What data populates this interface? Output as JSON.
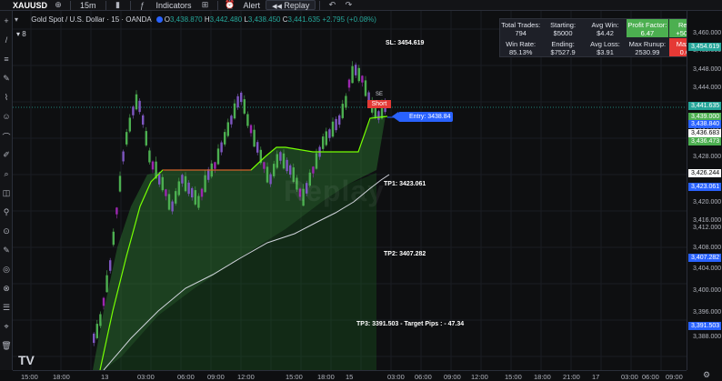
{
  "toolbar": {
    "symbol": "XAUUSD",
    "add_icon": "⊕",
    "interval": "15m",
    "chart_type_icon": "▮",
    "indicators_icon": "ƒ",
    "indicators": "Indicators",
    "layout_icon": "⊞",
    "alert_icon": "⏰",
    "alert": "Alert",
    "replay_icon": "◀◀",
    "replay": "Replay",
    "undo_icon": "↶",
    "redo_icon": "↷"
  },
  "legend": {
    "title": "Gold Spot / U.S. Dollar · 15 · OANDA",
    "o_label": "O",
    "o": "3,438.870",
    "h_label": "H",
    "h": "3,442.480",
    "l_label": "L",
    "l": "3,438.450",
    "c_label": "C",
    "c": "3,441.635",
    "change": "+2.795 (+0.08%)",
    "sub": "8"
  },
  "stats": [
    {
      "label": "Total Trades:",
      "value": "794"
    },
    {
      "label": "Starting:",
      "value": "$5000"
    },
    {
      "label": "Avg Win:",
      "value": "$4.42"
    },
    {
      "label": "Profit Factor:",
      "value": "6.47"
    },
    {
      "label": "Return:",
      "value": "+50.55%"
    },
    {
      "label": "Win Rate:",
      "value": "85.13%"
    },
    {
      "label": "Ending:",
      "value": "$7527.9"
    },
    {
      "label": "Avg Loss:",
      "value": "$3.91"
    },
    {
      "label": "Max Runup:",
      "value": "2530.99"
    },
    {
      "label": "Max DD:",
      "value": "0.65%"
    }
  ],
  "annotations": {
    "sl": "SL: 3454.619",
    "entry": "Entry: 3438.84",
    "tp1": "TP1: 3423.061",
    "tp2": "TP2: 3407.282",
    "tp3": "TP3: 3391.503 - Target Pips : - 47.34",
    "short": "Short",
    "se": "SE",
    "watermark": "Replay",
    "tv_logo": "TV"
  },
  "price_axis": {
    "ticks": [
      "3,460.000",
      "3,452.000",
      "3,448.000",
      "3,444.000",
      "3,432.000",
      "3,428.000",
      "3,420.000",
      "3,416.000",
      "3,412.000",
      "3,408.000",
      "3,404.000",
      "3,400.000",
      "3,396.000",
      "3,388.000"
    ],
    "labels": [
      {
        "text": "3,454.619",
        "color": "#26a69a"
      },
      {
        "text": "3,441.635",
        "color": "#26a69a"
      },
      {
        "text": "3,439.000",
        "color": "#4caf50"
      },
      {
        "text": "3,438.840",
        "color": "#2962ff"
      },
      {
        "text": "3,436.683",
        "color": "#ffffff"
      },
      {
        "text": "3,436.473",
        "color": "#4caf50"
      },
      {
        "text": "3,426.244",
        "color": "#ffffff"
      },
      {
        "text": "3,423.061",
        "color": "#2962ff"
      },
      {
        "text": "3,407.282",
        "color": "#2962ff"
      },
      {
        "text": "3,391.503",
        "color": "#2962ff"
      }
    ]
  },
  "time_axis": [
    "15:00",
    "18:00",
    "13",
    "03:00",
    "06:00",
    "09:00",
    "12:00",
    "15:00",
    "18:00",
    "15",
    "03:00",
    "06:00",
    "09:00",
    "12:00",
    "15:00",
    "18:00",
    "21:00",
    "17",
    "03:00",
    "06:00",
    "09:00"
  ],
  "left_tools": [
    "+",
    "/",
    "≡",
    "✎",
    "⌇",
    "☺",
    "⌒",
    "✐",
    "⌕",
    "◫",
    "⚲",
    "⊙",
    "✎",
    "◎",
    "⊗",
    "☰",
    "⌖",
    "🗑"
  ],
  "settings_icon": "⚙"
}
